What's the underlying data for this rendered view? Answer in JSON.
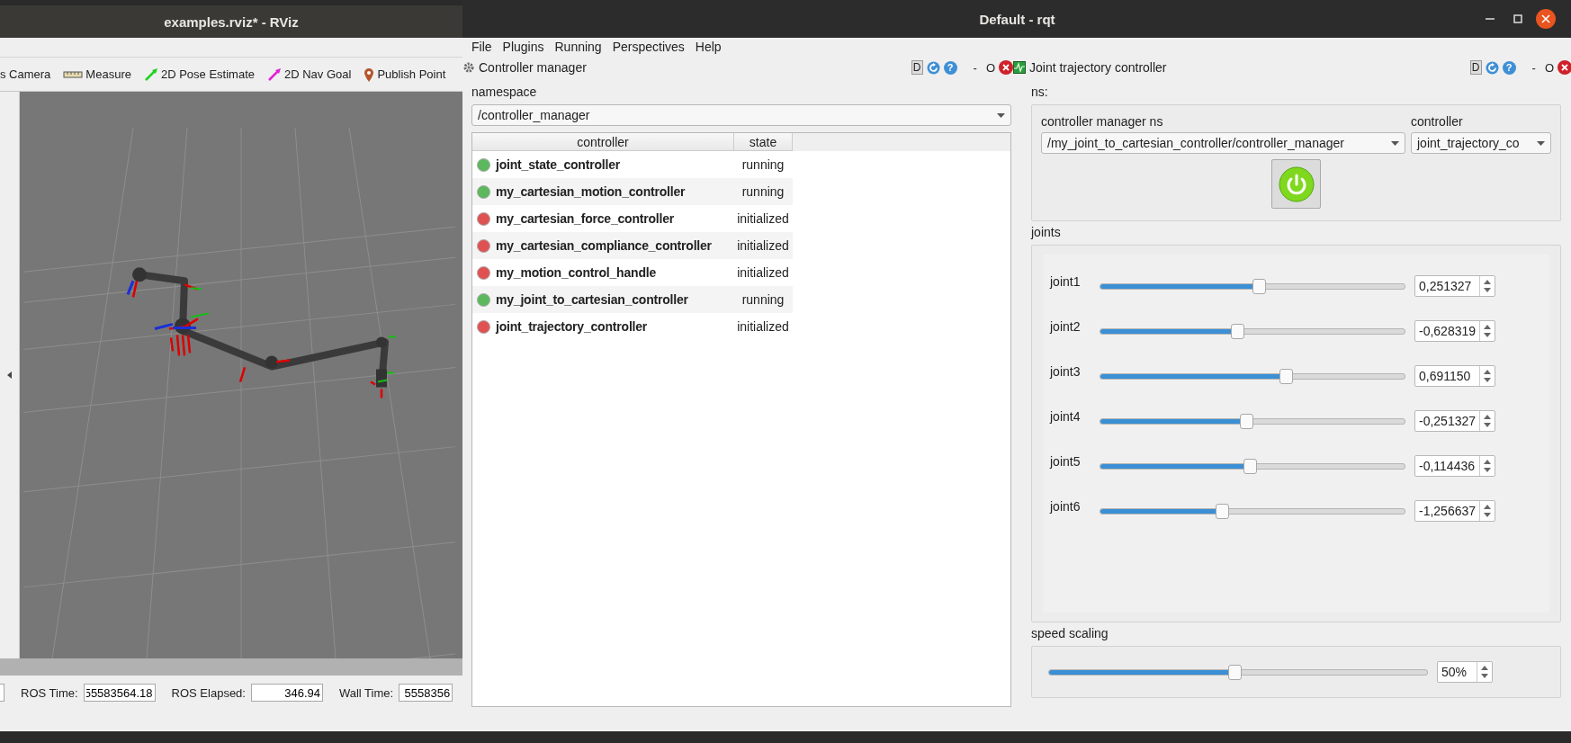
{
  "rviz": {
    "title": "examples.rviz* - RViz",
    "tools": [
      {
        "kind": "none",
        "label": "s Camera"
      },
      {
        "kind": "ruler",
        "label": "Measure"
      },
      {
        "kind": "pose-arrow",
        "label": "2D Pose Estimate"
      },
      {
        "kind": "nav-arrow",
        "label": "2D Nav Goal"
      },
      {
        "kind": "pin",
        "label": "Publish Point"
      }
    ],
    "time_bar": [
      {
        "label": "ROS Time:",
        "value": "55583564.18"
      },
      {
        "label": "ROS Elapsed:",
        "value": "346.94"
      },
      {
        "label": "Wall Time:",
        "value": "5558356"
      }
    ]
  },
  "rqt": {
    "title": "Default - rqt",
    "menu": [
      "File",
      "Plugins",
      "Running",
      "Perspectives",
      "Help"
    ],
    "plugins": [
      {
        "title": "Controller manager",
        "dock": "D",
        "help": "?",
        "minimize": "-",
        "restore": "O"
      },
      {
        "title": "Joint trajectory controller",
        "dock": "D",
        "help": "?",
        "minimize": "-",
        "restore": "O"
      }
    ],
    "controller_manager": {
      "namespace_label": "namespace",
      "namespace": "/controller_manager",
      "columns": [
        "controller",
        "state"
      ],
      "rows": [
        {
          "name": "joint_state_controller",
          "state": "running",
          "color": "#5cb85c"
        },
        {
          "name": "my_cartesian_motion_controller",
          "state": "running",
          "color": "#5cb85c"
        },
        {
          "name": "my_cartesian_force_controller",
          "state": "initialized",
          "color": "#e05252"
        },
        {
          "name": "my_cartesian_compliance_controller",
          "state": "initialized",
          "color": "#e05252"
        },
        {
          "name": "my_motion_control_handle",
          "state": "initialized",
          "color": "#e05252"
        },
        {
          "name": "my_joint_to_cartesian_controller",
          "state": "running",
          "color": "#5cb85c"
        },
        {
          "name": "joint_trajectory_controller",
          "state": "initialized",
          "color": "#e05252"
        }
      ]
    },
    "joint_trajectory": {
      "ns_label": "ns:",
      "cm_label": "controller manager ns",
      "cm_value": "/my_joint_to_cartesian_controller/controller_manager",
      "controller_label": "controller",
      "controller_value": "joint_trajectory_co",
      "power_on": true,
      "joints_label": "joints",
      "joints": [
        {
          "name": "joint1",
          "level": 0.52,
          "value": "0,251327"
        },
        {
          "name": "joint2",
          "level": 0.45,
          "value": "-0,628319"
        },
        {
          "name": "joint3",
          "level": 0.61,
          "value": "0,691150"
        },
        {
          "name": "joint4",
          "level": 0.48,
          "value": "-0,251327"
        },
        {
          "name": "joint5",
          "level": 0.49,
          "value": "-0,114436"
        },
        {
          "name": "joint6",
          "level": 0.4,
          "value": "-1,256637"
        }
      ],
      "speed_label": "speed scaling",
      "speed": {
        "level": 0.49,
        "value": "50%"
      }
    }
  }
}
